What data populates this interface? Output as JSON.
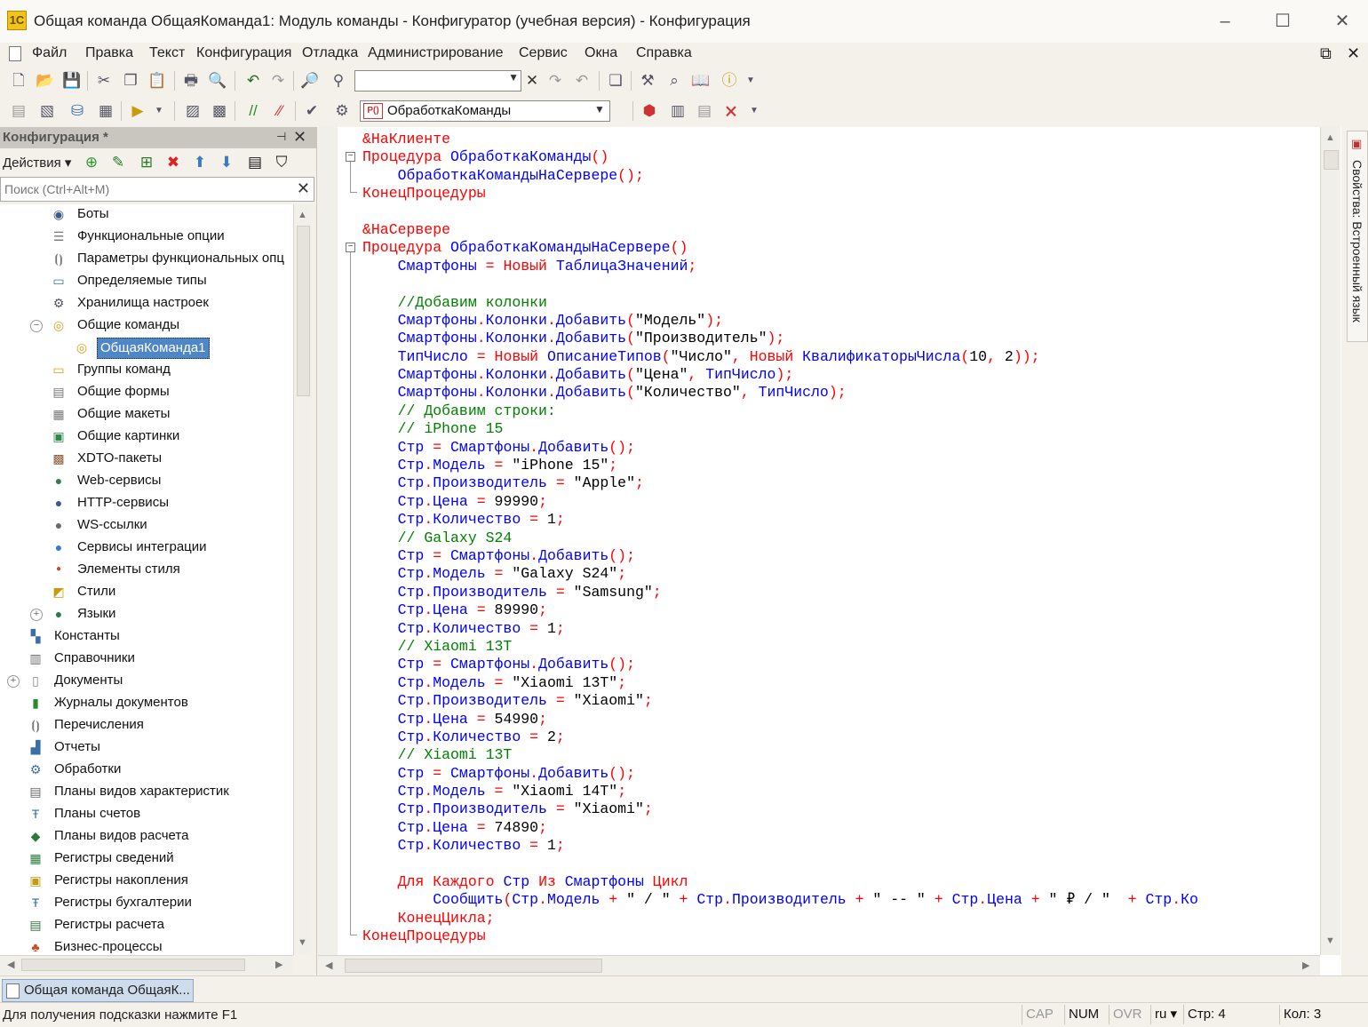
{
  "window": {
    "title": "Общая команда ОбщаяКоманда1: Модуль команды - Конфигуратор (учебная версия) - Конфигурация",
    "app_icon": "1С",
    "minimize": "–",
    "maximize": "☐",
    "close": "✕"
  },
  "menu": {
    "items": [
      "Файл",
      "Правка",
      "Текст",
      "Конфигурация",
      "Отладка",
      "Администрирование",
      "Сервис",
      "Окна",
      "Справка"
    ],
    "restore_icon": "⧉",
    "close_icon": "✕"
  },
  "toolbar2": {
    "module_combo": "ОбработкаКоманды",
    "module_combo_icon": "Р()"
  },
  "left_panel": {
    "title": "Конфигурация *",
    "pin": "⊣",
    "close": "✕",
    "actions_label": "Действия ▾",
    "search_placeholder": "Поиск (Ctrl+Alt+M)",
    "tree": [
      {
        "label": "Боты",
        "icon": "bots-icon"
      },
      {
        "label": "Функциональные опции",
        "icon": "functional-options-icon"
      },
      {
        "label": "Параметры функциональных опц",
        "icon": "functional-params-icon"
      },
      {
        "label": "Определяемые типы",
        "icon": "defined-types-icon"
      },
      {
        "label": "Хранилища настроек",
        "icon": "settings-storage-icon"
      },
      {
        "label": "Общие команды",
        "icon": "common-commands-icon"
      },
      {
        "label": "ОбщаяКоманда1",
        "icon": "command-icon"
      },
      {
        "label": "Группы команд",
        "icon": "command-groups-icon"
      },
      {
        "label": "Общие формы",
        "icon": "common-forms-icon"
      },
      {
        "label": "Общие макеты",
        "icon": "common-templates-icon"
      },
      {
        "label": "Общие картинки",
        "icon": "common-pictures-icon"
      },
      {
        "label": "XDTO-пакеты",
        "icon": "xdto-packages-icon"
      },
      {
        "label": "Web-сервисы",
        "icon": "web-services-icon"
      },
      {
        "label": "HTTP-сервисы",
        "icon": "http-services-icon"
      },
      {
        "label": "WS-ссылки",
        "icon": "ws-links-icon"
      },
      {
        "label": "Сервисы интеграции",
        "icon": "integration-services-icon"
      },
      {
        "label": "Элементы стиля",
        "icon": "style-items-icon"
      },
      {
        "label": "Стили",
        "icon": "styles-icon"
      },
      {
        "label": "Языки",
        "icon": "languages-icon"
      },
      {
        "label": "Константы",
        "icon": "constants-icon"
      },
      {
        "label": "Справочники",
        "icon": "catalogs-icon"
      },
      {
        "label": "Документы",
        "icon": "documents-icon"
      },
      {
        "label": "Журналы документов",
        "icon": "document-journals-icon"
      },
      {
        "label": "Перечисления",
        "icon": "enums-icon"
      },
      {
        "label": "Отчеты",
        "icon": "reports-icon"
      },
      {
        "label": "Обработки",
        "icon": "data-processors-icon"
      },
      {
        "label": "Планы видов характеристик",
        "icon": "chart-of-characteristics-icon"
      },
      {
        "label": "Планы счетов",
        "icon": "chart-of-accounts-icon"
      },
      {
        "label": "Планы видов расчета",
        "icon": "chart-of-calculation-icon"
      },
      {
        "label": "Регистры сведений",
        "icon": "information-registers-icon"
      },
      {
        "label": "Регистры накопления",
        "icon": "accumulation-registers-icon"
      },
      {
        "label": "Регистры бухгалтерии",
        "icon": "accounting-registers-icon"
      },
      {
        "label": "Регистры расчета",
        "icon": "calculation-registers-icon"
      },
      {
        "label": "Бизнес-процессы",
        "icon": "business-processes-icon"
      }
    ]
  },
  "editor": {
    "lines": [
      "&НаКлиенте",
      "Процедура ОбработкаКоманды()",
      "    ОбработкаКомандыНаСервере();",
      "КонецПроцедуры",
      "",
      "&НаСервере",
      "Процедура ОбработкаКомандыНаСервере()",
      "    Смартфоны = Новый ТаблицаЗначений;",
      "",
      "    //Добавим колонки",
      "    Смартфоны.Колонки.Добавить(\"Модель\");",
      "    Смартфоны.Колонки.Добавить(\"Производитель\");",
      "    ТипЧисло = Новый ОписаниеТипов(\"Число\", Новый КвалификаторыЧисла(10, 2));",
      "    Смартфоны.Колонки.Добавить(\"Цена\", ТипЧисло);",
      "    Смартфоны.Колонки.Добавить(\"Количество\", ТипЧисло);",
      "    // Добавим строки:",
      "    // iPhone 15",
      "    Стр = Смартфоны.Добавить();",
      "    Стр.Модель = \"iPhone 15\";",
      "    Стр.Производитель = \"Apple\";",
      "    Стр.Цена = 99990;",
      "    Стр.Количество = 1;",
      "    // Galaxy S24",
      "    Стр = Смартфоны.Добавить();",
      "    Стр.Модель = \"Galaxy S24\";",
      "    Стр.Производитель = \"Samsung\";",
      "    Стр.Цена = 89990;",
      "    Стр.Количество = 1;",
      "    // Xiaomi 13T",
      "    Стр = Смартфоны.Добавить();",
      "    Стр.Модель = \"Xiaomi 13T\";",
      "    Стр.Производитель = \"Xiaomi\";",
      "    Стр.Цена = 54990;",
      "    Стр.Количество = 2;",
      "    // Xiaomi 13T",
      "    Стр = Смартфоны.Добавить();",
      "    Стр.Модель = \"Xiaomi 14T\";",
      "    Стр.Производитель = \"Xiaomi\";",
      "    Стр.Цена = 74890;",
      "    Стр.Количество = 1;",
      "",
      "    Для Каждого Стр Из Смартфоны Цикл",
      "        Сообщить(Стр.Модель + \" / \" + Стр.Производитель + \" -- \" + Стр.Цена + \" ₽ / \"  + Стр.Ко",
      "    КонецЦикла;",
      "КонецПроцедуры"
    ]
  },
  "right_strip": {
    "tab_label": "Свойства: Встроенный язык"
  },
  "taskbar": {
    "tab_label": "Общая команда ОбщаяК..."
  },
  "status": {
    "hint": "Для получения подсказки нажмите F1",
    "cap": "CAP",
    "num": "NUM",
    "ovr": "OVR",
    "lang": "ru ▾",
    "line": "Стр: 4",
    "col": "Кол: 3"
  },
  "colors": {
    "keyword": "#ff0000",
    "identifier": "#0000ff",
    "comment": "#008000",
    "literal": "#000000",
    "selection": "#4f86c6"
  }
}
